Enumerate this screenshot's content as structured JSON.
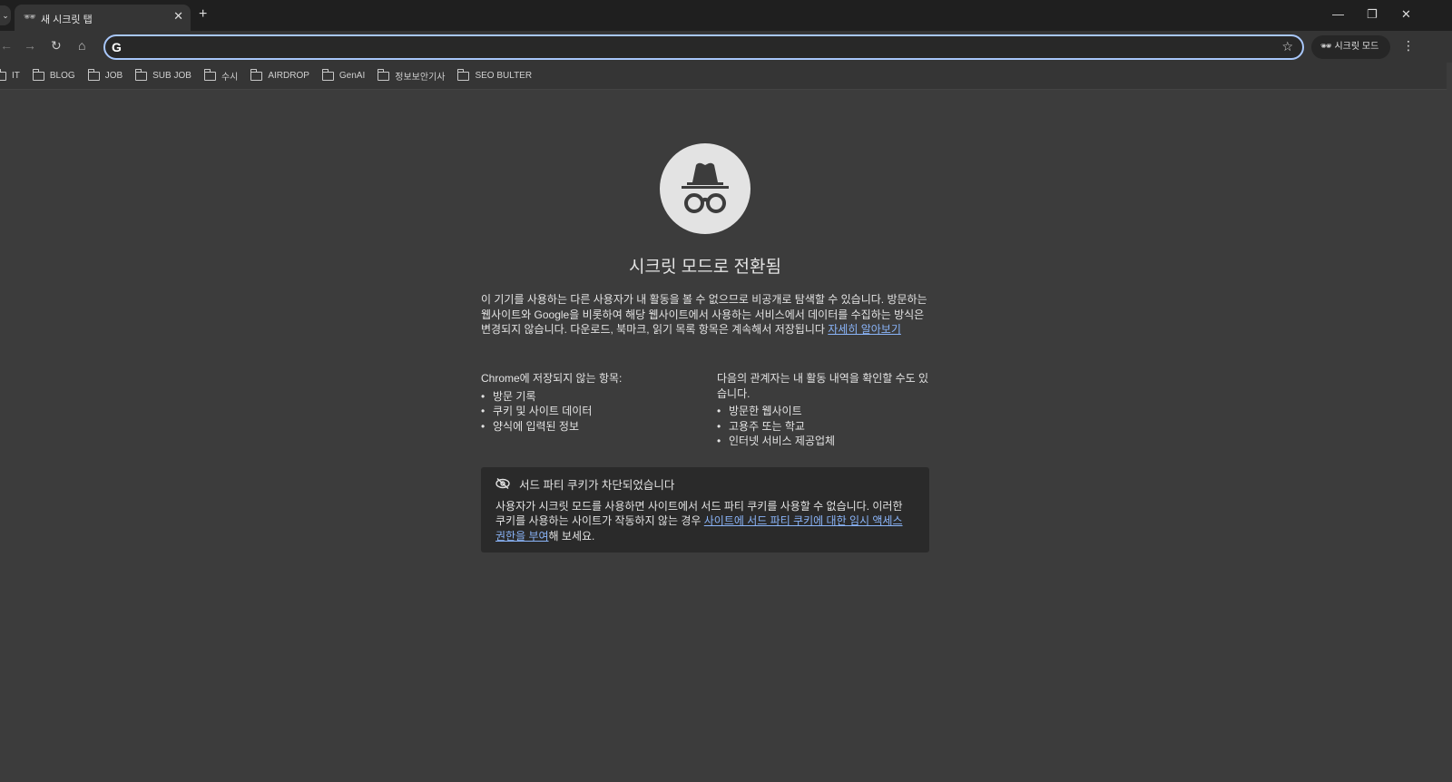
{
  "tab": {
    "title": "새 시크릿 탭"
  },
  "omnibox": {
    "value": "",
    "placeholder": ""
  },
  "incognito_badge": "시크릿 모드",
  "bookmarks": [
    "IT",
    "BLOG",
    "JOB",
    "SUB JOB",
    "수시",
    "AIRDROP",
    "GenAI",
    "정보보안기사",
    "SEO BULTER"
  ],
  "page": {
    "title": "시크릿 모드로 전환됨",
    "intro": "이 기기를 사용하는 다른 사용자가 내 활동을 볼 수 없으므로 비공개로 탐색할 수 있습니다. 방문하는 웹사이트와 Google을 비롯하여 해당 웹사이트에서 사용하는 서비스에서 데이터를 수집하는 방식은 변경되지 않습니다. 다운로드, 북마크, 읽기 목록 항목은 계속해서 저장됩니다 ",
    "learn_more": "자세히 알아보기",
    "left_heading": "Chrome에 저장되지 않는 항목:",
    "left_items": [
      "방문 기록",
      "쿠키 및 사이트 데이터",
      "양식에 입력된 정보"
    ],
    "right_heading": "다음의 관계자는 내 활동 내역을 확인할 수도 있습니다.",
    "right_items": [
      "방문한 웹사이트",
      "고용주 또는 학교",
      "인터넷 서비스 제공업체"
    ],
    "cookie_title": "서드 파티 쿠키가 차단되었습니다",
    "cookie_text": "사용자가 시크릿 모드를 사용하면 사이트에서 서드 파티 쿠키를 사용할 수 없습니다. 이러한 쿠키를 사용하는 사이트가 작동하지 않는 경우 ",
    "cookie_link": "사이트에 서드 파티 쿠키에 대한 임시 액세스 권한을 부여",
    "cookie_tail": "해 보세요."
  }
}
